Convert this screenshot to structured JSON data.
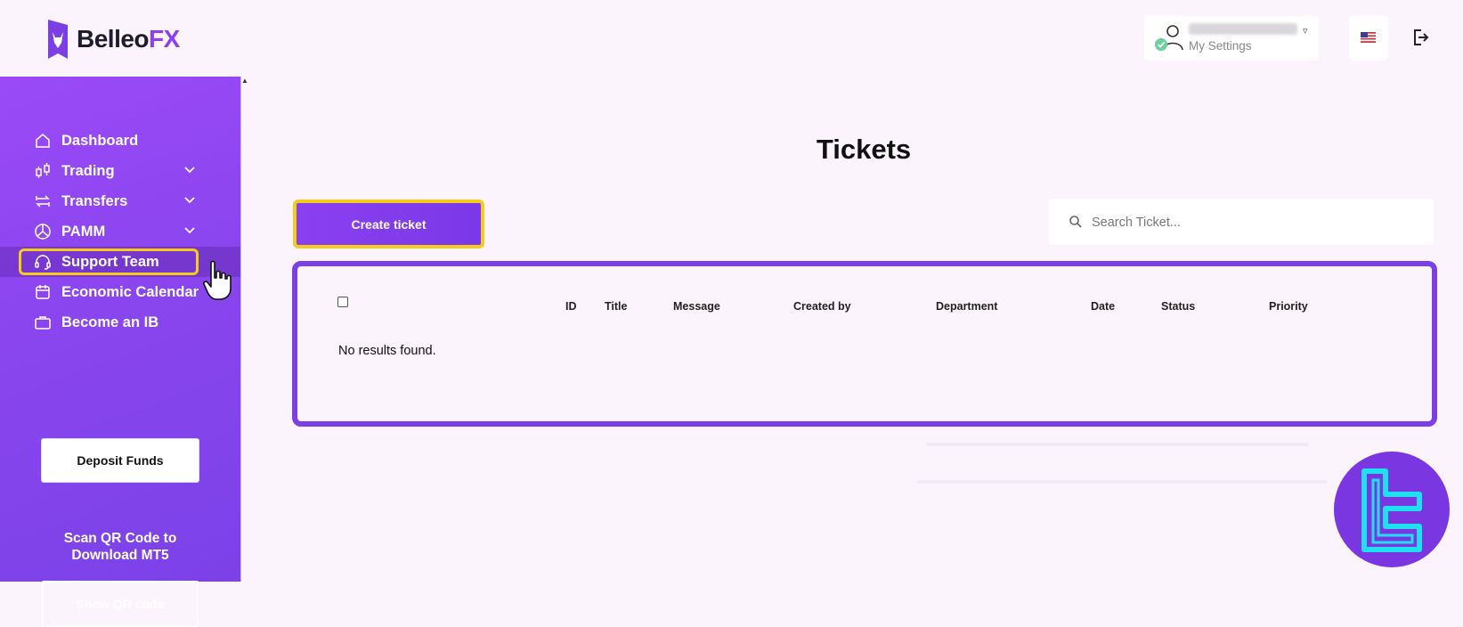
{
  "header": {
    "logo_text_main": "Belleo",
    "logo_text_accent": "FX",
    "settings_label": "My Settings",
    "flag_icon": "us-flag-icon",
    "logout_icon": "logout-icon"
  },
  "sidebar": {
    "items": [
      {
        "label": "Dashboard",
        "icon": "home-icon",
        "has_chevron": false
      },
      {
        "label": "Trading",
        "icon": "candlestick-icon",
        "has_chevron": true
      },
      {
        "label": "Transfers",
        "icon": "transfer-icon",
        "has_chevron": true
      },
      {
        "label": "PAMM",
        "icon": "pie-chart-icon",
        "has_chevron": true
      },
      {
        "label": "Support Team",
        "icon": "headset-icon",
        "has_chevron": false,
        "active": true
      },
      {
        "label": "Economic Calendar",
        "icon": "calendar-icon",
        "has_chevron": false
      },
      {
        "label": "Become an IB",
        "icon": "briefcase-icon",
        "has_chevron": false
      }
    ],
    "deposit_label": "Deposit Funds",
    "qr_text_line1": "Scan QR Code to",
    "qr_text_line2": "Download MT5",
    "qr_button_label": "Show QR code"
  },
  "main": {
    "title": "Tickets",
    "create_button_label": "Create ticket",
    "search_placeholder": "Search Ticket...",
    "table": {
      "columns": [
        "ID",
        "Title",
        "Message",
        "Created by",
        "Department",
        "Date",
        "Status",
        "Priority"
      ],
      "empty_text": "No results found."
    }
  },
  "colors": {
    "accent": "#8a3ff0",
    "highlight": "#f5cc1a",
    "sidebar": "#8a45ee",
    "background": "#fcf4fc"
  }
}
